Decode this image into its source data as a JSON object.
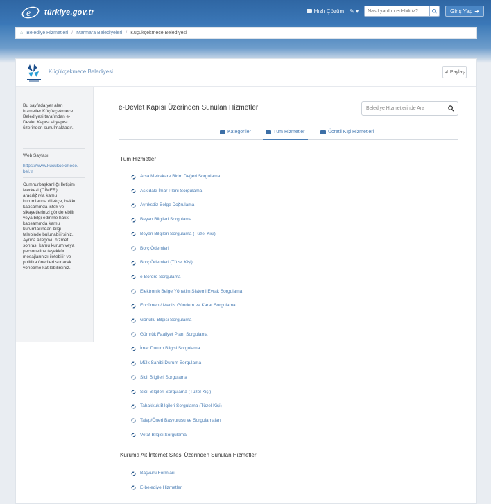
{
  "header": {
    "brand": "türkiye.gov.tr",
    "help": "Hızlı Çözüm",
    "search_placeholder": "Nasıl yardım edebiliriz?",
    "login": "Giriş Yap"
  },
  "breadcrumb": [
    "Belediye Hizmetleri",
    "Marmara Belediyeleri",
    "Küçükçekmece Belediyesi"
  ],
  "institution": {
    "name": "Küçükçekmece Belediyesi",
    "share": "Paylaş"
  },
  "sidebar": {
    "intro": "Bu sayfada yer alan hizmetler Küçükçekmece Belediyesi tarafından e-Devlet Kapısı altyapısı üzerinden sunulmaktadır.",
    "web_label": "Web Sayfası",
    "web_link": "https://www.kucukcekmece.bel.tr",
    "note": "Cumhurbaşkanlığı İletişim Merkezi (CİMER) aracılığıyla kamu kurumlarına dilekçe, hakkı kapsamında istek ve şikayetlerinizi gönderebilir veya bilgi edinme hakkı kapsamında kamu kurumlarından bilgi talebinde bulunabilirsiniz. Ayrıca ailegovu hizmet sonrası kamu kurum veya personeline teşekkür mesajlarınızı iletebilir ve politika önerileri sunarak yönetime katılabilirsiniz."
  },
  "main": {
    "title": "e-Devlet Kapısı Üzerinden Sunulan Hizmetler",
    "search_placeholder": "Belediye Hizmetlerinde Ara",
    "tabs": [
      "Kategoriler",
      "Tüm Hizmetler",
      "Ücretli Kişi Hizmetleri"
    ],
    "all_services_title": "Tüm Hizmetler",
    "services": [
      "Arsa Metrekare Birim Değeri Sorgulama",
      "Askıdaki İmar Planı Sorgulama",
      "Ayrıksdiz Belge Doğrulama",
      "Beyan Bilgileri Sorgulama",
      "Beyan Bilgileri Sorgulama (Tüzel Kişi)",
      "Borç Ödemleri",
      "Borç Ödemleri (Tüzel Kişi)",
      "e-Bordro Sorgulama",
      "Elektronik Belge Yönetim Sistemi Evrak Sorgulama",
      "Encümen / Meclis Gündem ve Karar Sorgulama",
      "Gönüllü Bilgisi Sorgulama",
      "Gümrük Faaliyet Planı Sorgulama",
      "İmar Durum Bilgisi Sorgulama",
      "Mülk Sahibi Durum Sorgulama",
      "Sicil Bilgileri Sorgulama",
      "Sicil Bilgileri Sorgulama (Tüzel Kişi)",
      "Tahakkuk Bilgileri Sorgulama (Tüzel Kişi)",
      "Talep/Öneri Başvurusu ve Sorgulamaları",
      "Vefat Bilgisi Sorgulama"
    ],
    "external_title": "Kuruma Ait İnternet Sitesi Üzerinden Sunulan Hizmetler",
    "external_services": [
      "Başvuru Formları",
      "E-belediye Hizmetleri"
    ]
  },
  "colors": {
    "header_blue": "#3b78b8",
    "link_blue": "#4a7db4"
  }
}
